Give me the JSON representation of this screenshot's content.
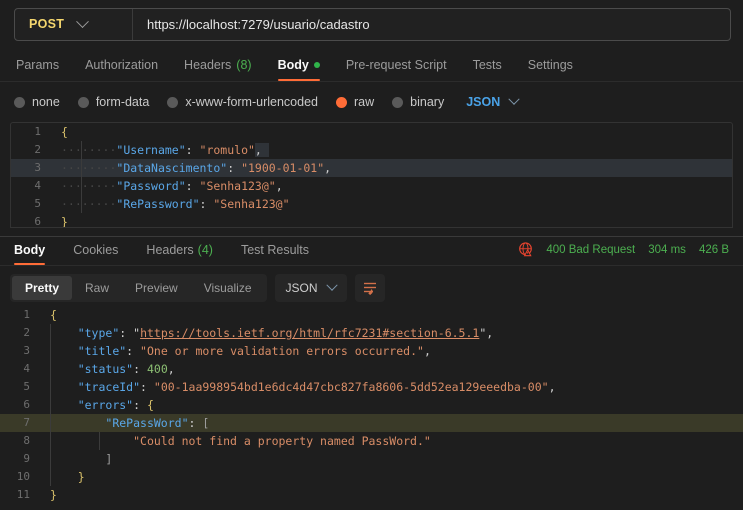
{
  "request": {
    "method": "POST",
    "url": "https://localhost:7279/usuario/cadastro",
    "method_caret_icon": "chevron-down-icon",
    "tabs": [
      {
        "label": "Params",
        "active": false,
        "count": null,
        "dot": false
      },
      {
        "label": "Authorization",
        "active": false,
        "count": null,
        "dot": false
      },
      {
        "label": "Headers",
        "active": false,
        "count": "(8)",
        "dot": false
      },
      {
        "label": "Body",
        "active": true,
        "count": null,
        "dot": true
      },
      {
        "label": "Pre-request Script",
        "active": false,
        "count": null,
        "dot": false
      },
      {
        "label": "Tests",
        "active": false,
        "count": null,
        "dot": false
      },
      {
        "label": "Settings",
        "active": false,
        "count": null,
        "dot": false
      }
    ],
    "body_types": [
      {
        "label": "none",
        "selected": false
      },
      {
        "label": "form-data",
        "selected": false
      },
      {
        "label": "x-www-form-urlencoded",
        "selected": false
      },
      {
        "label": "raw",
        "selected": true
      },
      {
        "label": "binary",
        "selected": false
      }
    ],
    "format": "JSON",
    "format_caret_icon": "chevron-down-icon",
    "body_lines": [
      {
        "num": "1",
        "text": "{"
      },
      {
        "num": "2",
        "text": "        \"Username\": \"romulo\","
      },
      {
        "num": "3",
        "text": "        \"DataNascimento\": \"1900-01-01\","
      },
      {
        "num": "4",
        "text": "        \"Password\": \"Senha123@\","
      },
      {
        "num": "5",
        "text": "        \"RePassword\": \"Senha123@\""
      },
      {
        "num": "6",
        "text": "}"
      }
    ]
  },
  "response": {
    "tabs": [
      {
        "label": "Body",
        "active": true,
        "count": null
      },
      {
        "label": "Cookies",
        "active": false,
        "count": null
      },
      {
        "label": "Headers",
        "active": false,
        "count": "(4)"
      },
      {
        "label": "Test Results",
        "active": false,
        "count": null
      }
    ],
    "status_icon": "globe-warning-icon",
    "status": "400 Bad Request",
    "time": "304 ms",
    "size": "426 B",
    "view_modes": [
      {
        "label": "Pretty",
        "active": true
      },
      {
        "label": "Raw",
        "active": false
      },
      {
        "label": "Preview",
        "active": false
      },
      {
        "label": "Visualize",
        "active": false
      }
    ],
    "format": "JSON",
    "format_caret_icon": "chevron-down-icon",
    "wrap_icon": "word-wrap-icon",
    "body_lines": [
      {
        "num": "1",
        "text": "{"
      },
      {
        "num": "2",
        "text": "    \"type\": \"https://tools.ietf.org/html/rfc7231#section-6.5.1\","
      },
      {
        "num": "3",
        "text": "    \"title\": \"One or more validation errors occurred.\","
      },
      {
        "num": "4",
        "text": "    \"status\": 400,"
      },
      {
        "num": "5",
        "text": "    \"traceId\": \"00-1aa998954bd1e6dc4d47cbc827fa8606-5dd52ea129eeedba-00\","
      },
      {
        "num": "6",
        "text": "    \"errors\": {"
      },
      {
        "num": "7",
        "text": "        \"RePassWord\": ["
      },
      {
        "num": "8",
        "text": "            \"Could not find a property named PassWord.\""
      },
      {
        "num": "9",
        "text": "        ]"
      },
      {
        "num": "10",
        "text": "    }"
      },
      {
        "num": "11",
        "text": "}"
      }
    ],
    "values": {
      "type": "https://tools.ietf.org/html/rfc7231#section-6.5.1",
      "title": "One or more validation errors occurred.",
      "status": "400",
      "traceId": "00-1aa998954bd1e6dc4d47cbc827fa8606-5dd52ea129eeedba-00",
      "error_key": "RePassWord",
      "error_message": "Could not find a property named PassWord."
    }
  },
  "colors": {
    "accent": "#ff6c37",
    "method": "#f5d76e",
    "success": "#4caf50",
    "error": "#e8442f",
    "key": "#5aa7e8",
    "string": "#d98d67",
    "background": "#1e1e1e"
  }
}
